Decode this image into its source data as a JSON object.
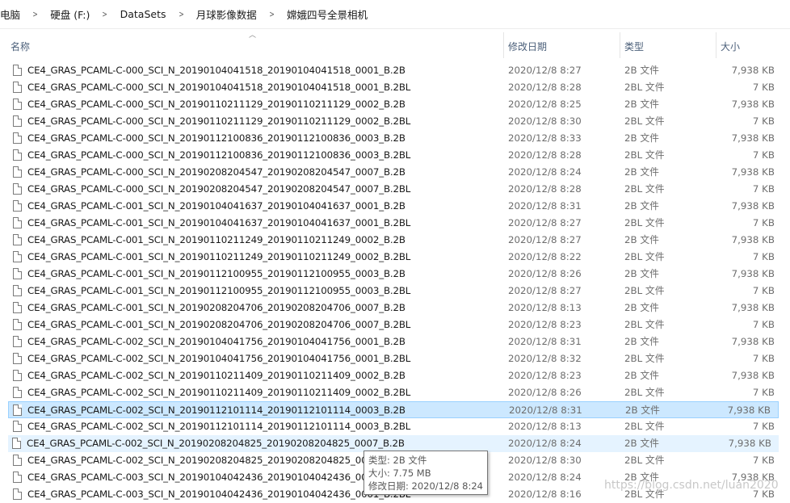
{
  "breadcrumb": [
    "电脑",
    "硬盘 (F:)",
    "DataSets",
    "月球影像数据",
    "嫦娥四号全景相机"
  ],
  "columns": {
    "name": "名称",
    "date": "修改日期",
    "type": "类型",
    "size": "大小"
  },
  "files": [
    {
      "name": "CE4_GRAS_PCAML-C-000_SCI_N_20190104041518_20190104041518_0001_B.2B",
      "date": "2020/12/8 8:27",
      "type": "2B 文件",
      "size": "7,938 KB"
    },
    {
      "name": "CE4_GRAS_PCAML-C-000_SCI_N_20190104041518_20190104041518_0001_B.2BL",
      "date": "2020/12/8 8:28",
      "type": "2BL 文件",
      "size": "7 KB"
    },
    {
      "name": "CE4_GRAS_PCAML-C-000_SCI_N_20190110211129_20190110211129_0002_B.2B",
      "date": "2020/12/8 8:25",
      "type": "2B 文件",
      "size": "7,938 KB"
    },
    {
      "name": "CE4_GRAS_PCAML-C-000_SCI_N_20190110211129_20190110211129_0002_B.2BL",
      "date": "2020/12/8 8:30",
      "type": "2BL 文件",
      "size": "7 KB"
    },
    {
      "name": "CE4_GRAS_PCAML-C-000_SCI_N_20190112100836_20190112100836_0003_B.2B",
      "date": "2020/12/8 8:33",
      "type": "2B 文件",
      "size": "7,938 KB"
    },
    {
      "name": "CE4_GRAS_PCAML-C-000_SCI_N_20190112100836_20190112100836_0003_B.2BL",
      "date": "2020/12/8 8:28",
      "type": "2BL 文件",
      "size": "7 KB"
    },
    {
      "name": "CE4_GRAS_PCAML-C-000_SCI_N_20190208204547_20190208204547_0007_B.2B",
      "date": "2020/12/8 8:24",
      "type": "2B 文件",
      "size": "7,938 KB"
    },
    {
      "name": "CE4_GRAS_PCAML-C-000_SCI_N_20190208204547_20190208204547_0007_B.2BL",
      "date": "2020/12/8 8:28",
      "type": "2BL 文件",
      "size": "7 KB"
    },
    {
      "name": "CE4_GRAS_PCAML-C-001_SCI_N_20190104041637_20190104041637_0001_B.2B",
      "date": "2020/12/8 8:31",
      "type": "2B 文件",
      "size": "7,938 KB"
    },
    {
      "name": "CE4_GRAS_PCAML-C-001_SCI_N_20190104041637_20190104041637_0001_B.2BL",
      "date": "2020/12/8 8:27",
      "type": "2BL 文件",
      "size": "7 KB"
    },
    {
      "name": "CE4_GRAS_PCAML-C-001_SCI_N_20190110211249_20190110211249_0002_B.2B",
      "date": "2020/12/8 8:27",
      "type": "2B 文件",
      "size": "7,938 KB"
    },
    {
      "name": "CE4_GRAS_PCAML-C-001_SCI_N_20190110211249_20190110211249_0002_B.2BL",
      "date": "2020/12/8 8:22",
      "type": "2BL 文件",
      "size": "7 KB"
    },
    {
      "name": "CE4_GRAS_PCAML-C-001_SCI_N_20190112100955_20190112100955_0003_B.2B",
      "date": "2020/12/8 8:26",
      "type": "2B 文件",
      "size": "7,938 KB"
    },
    {
      "name": "CE4_GRAS_PCAML-C-001_SCI_N_20190112100955_20190112100955_0003_B.2BL",
      "date": "2020/12/8 8:27",
      "type": "2BL 文件",
      "size": "7 KB"
    },
    {
      "name": "CE4_GRAS_PCAML-C-001_SCI_N_20190208204706_20190208204706_0007_B.2B",
      "date": "2020/12/8 8:13",
      "type": "2B 文件",
      "size": "7,938 KB"
    },
    {
      "name": "CE4_GRAS_PCAML-C-001_SCI_N_20190208204706_20190208204706_0007_B.2BL",
      "date": "2020/12/8 8:23",
      "type": "2BL 文件",
      "size": "7 KB"
    },
    {
      "name": "CE4_GRAS_PCAML-C-002_SCI_N_20190104041756_20190104041756_0001_B.2B",
      "date": "2020/12/8 8:31",
      "type": "2B 文件",
      "size": "7,938 KB"
    },
    {
      "name": "CE4_GRAS_PCAML-C-002_SCI_N_20190104041756_20190104041756_0001_B.2BL",
      "date": "2020/12/8 8:32",
      "type": "2BL 文件",
      "size": "7 KB"
    },
    {
      "name": "CE4_GRAS_PCAML-C-002_SCI_N_20190110211409_20190110211409_0002_B.2B",
      "date": "2020/12/8 8:23",
      "type": "2B 文件",
      "size": "7,938 KB"
    },
    {
      "name": "CE4_GRAS_PCAML-C-002_SCI_N_20190110211409_20190110211409_0002_B.2BL",
      "date": "2020/12/8 8:26",
      "type": "2BL 文件",
      "size": "7 KB"
    },
    {
      "name": "CE4_GRAS_PCAML-C-002_SCI_N_20190112101114_20190112101114_0003_B.2B",
      "date": "2020/12/8 8:31",
      "type": "2B 文件",
      "size": "7,938 KB"
    },
    {
      "name": "CE4_GRAS_PCAML-C-002_SCI_N_20190112101114_20190112101114_0003_B.2BL",
      "date": "2020/12/8 8:13",
      "type": "2BL 文件",
      "size": "7 KB"
    },
    {
      "name": "CE4_GRAS_PCAML-C-002_SCI_N_20190208204825_20190208204825_0007_B.2B",
      "date": "2020/12/8 8:24",
      "type": "2B 文件",
      "size": "7,938 KB"
    },
    {
      "name": "CE4_GRAS_PCAML-C-002_SCI_N_20190208204825_20190208204825_000",
      "date": "2020/12/8 8:30",
      "type": "2BL 文件",
      "size": "7 KB"
    },
    {
      "name": "CE4_GRAS_PCAML-C-003_SCI_N_20190104042436_20190104042436_000",
      "date": "2020/12/8 8:24",
      "type": "2B 文件",
      "size": "7,938 KB"
    },
    {
      "name": "CE4_GRAS_PCAML-C-003_SCI_N_20190104042436_20190104042436_0001_B.2BL",
      "date": "2020/12/8 8:16",
      "type": "2BL 文件",
      "size": "7 KB"
    }
  ],
  "selected_row": 20,
  "hover_row": 22,
  "tooltip": {
    "type": "类型: 2B 文件",
    "size": "大小: 7.75 MB",
    "modified": "修改日期: 2020/12/8 8:24"
  },
  "watermark": "https://blog.csdn.net/luan2020"
}
